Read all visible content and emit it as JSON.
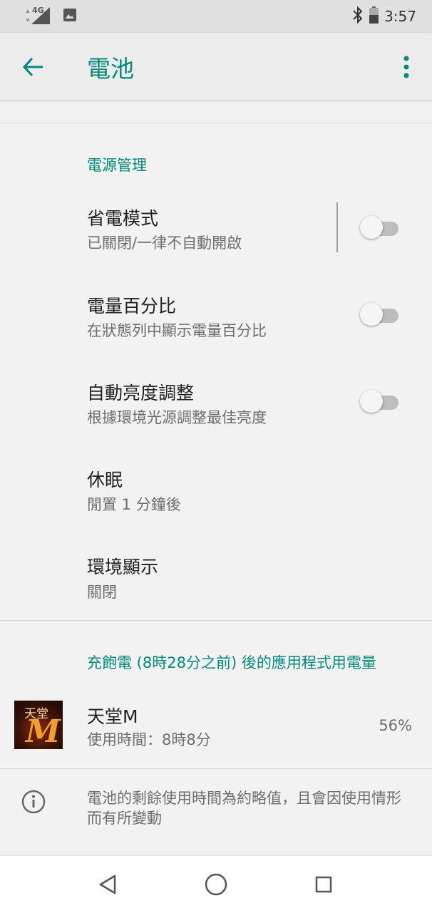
{
  "status_bar": {
    "network": "4G",
    "time": "3:57"
  },
  "app_bar": {
    "title": "電池"
  },
  "power_section": {
    "header": "電源管理",
    "items": [
      {
        "title": "省電模式",
        "subtitle": "已關閉/一律不自動開啟",
        "switch_on": false
      },
      {
        "title": "電量百分比",
        "subtitle": "在狀態列中顯示電量百分比",
        "switch_on": false
      },
      {
        "title": "自動亮度調整",
        "subtitle": "根據環境光源調整最佳亮度",
        "switch_on": false
      },
      {
        "title": "休眠",
        "subtitle": "閒置 1 分鐘後"
      },
      {
        "title": "環境顯示",
        "subtitle": "關閉"
      }
    ]
  },
  "usage_section": {
    "header": "充飽電 (8時28分之前) 後的應用程式用電量",
    "apps": [
      {
        "icon_text": "天堂",
        "icon_letter": "M",
        "name": "天堂M",
        "usage": "使用時間：8時8分",
        "percent": "56%"
      }
    ]
  },
  "footer_info": {
    "text": "電池的剩餘使用時間為約略值，且會因使用情形而有所變動"
  },
  "colors": {
    "accent": "#00897b",
    "background": "#f2f2f2"
  },
  "icons": [
    "signal-icon",
    "image-icon",
    "bluetooth-icon",
    "battery-icon",
    "back-arrow-icon",
    "overflow-menu-icon",
    "info-icon",
    "nav-back-icon",
    "nav-home-icon",
    "nav-recents-icon"
  ]
}
